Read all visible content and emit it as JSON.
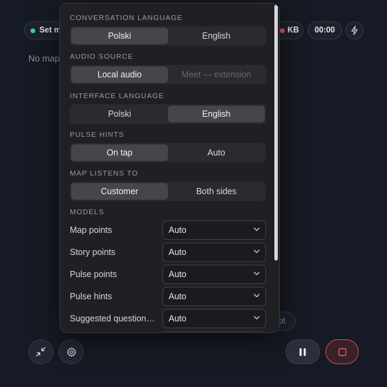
{
  "header": {
    "set_map_label": "Set m",
    "kb_label": "KB",
    "timer": "00:00"
  },
  "main": {
    "no_map_text": "No map",
    "prompt_fragment": "pt"
  },
  "colors": {
    "status_ok": "#3bd08a",
    "status_alert": "#e0566a",
    "stop_border": "#d14a5c"
  },
  "icons": {
    "bolt": "bolt-icon",
    "collapse": "collapse-icon",
    "settings": "gear-icon",
    "pause": "pause-icon",
    "stop": "stop-icon",
    "chevron": "chevron-down-icon"
  },
  "settings": {
    "conversation_language": {
      "label": "CONVERSATION LANGUAGE",
      "options": [
        "Polski",
        "English"
      ],
      "selected": "Polski"
    },
    "audio_source": {
      "label": "AUDIO SOURCE",
      "options": [
        "Local audio",
        "Meet — extension"
      ],
      "selected": "Local audio"
    },
    "interface_language": {
      "label": "INTERFACE LANGUAGE",
      "options": [
        "Polski",
        "English"
      ],
      "selected": "English"
    },
    "pulse_hints": {
      "label": "PULSE HINTS",
      "options": [
        "On tap",
        "Auto"
      ],
      "selected": "On tap"
    },
    "map_listens_to": {
      "label": "MAP LISTENS TO",
      "options": [
        "Customer",
        "Both sides"
      ],
      "selected": "Customer"
    },
    "models": {
      "label": "MODELS",
      "rows": [
        {
          "label": "Map points",
          "value": "Auto"
        },
        {
          "label": "Story points",
          "value": "Auto"
        },
        {
          "label": "Pulse points",
          "value": "Auto"
        },
        {
          "label": "Pulse hints",
          "value": "Auto"
        },
        {
          "label": "Suggested questions …",
          "value": "Auto"
        }
      ]
    }
  }
}
